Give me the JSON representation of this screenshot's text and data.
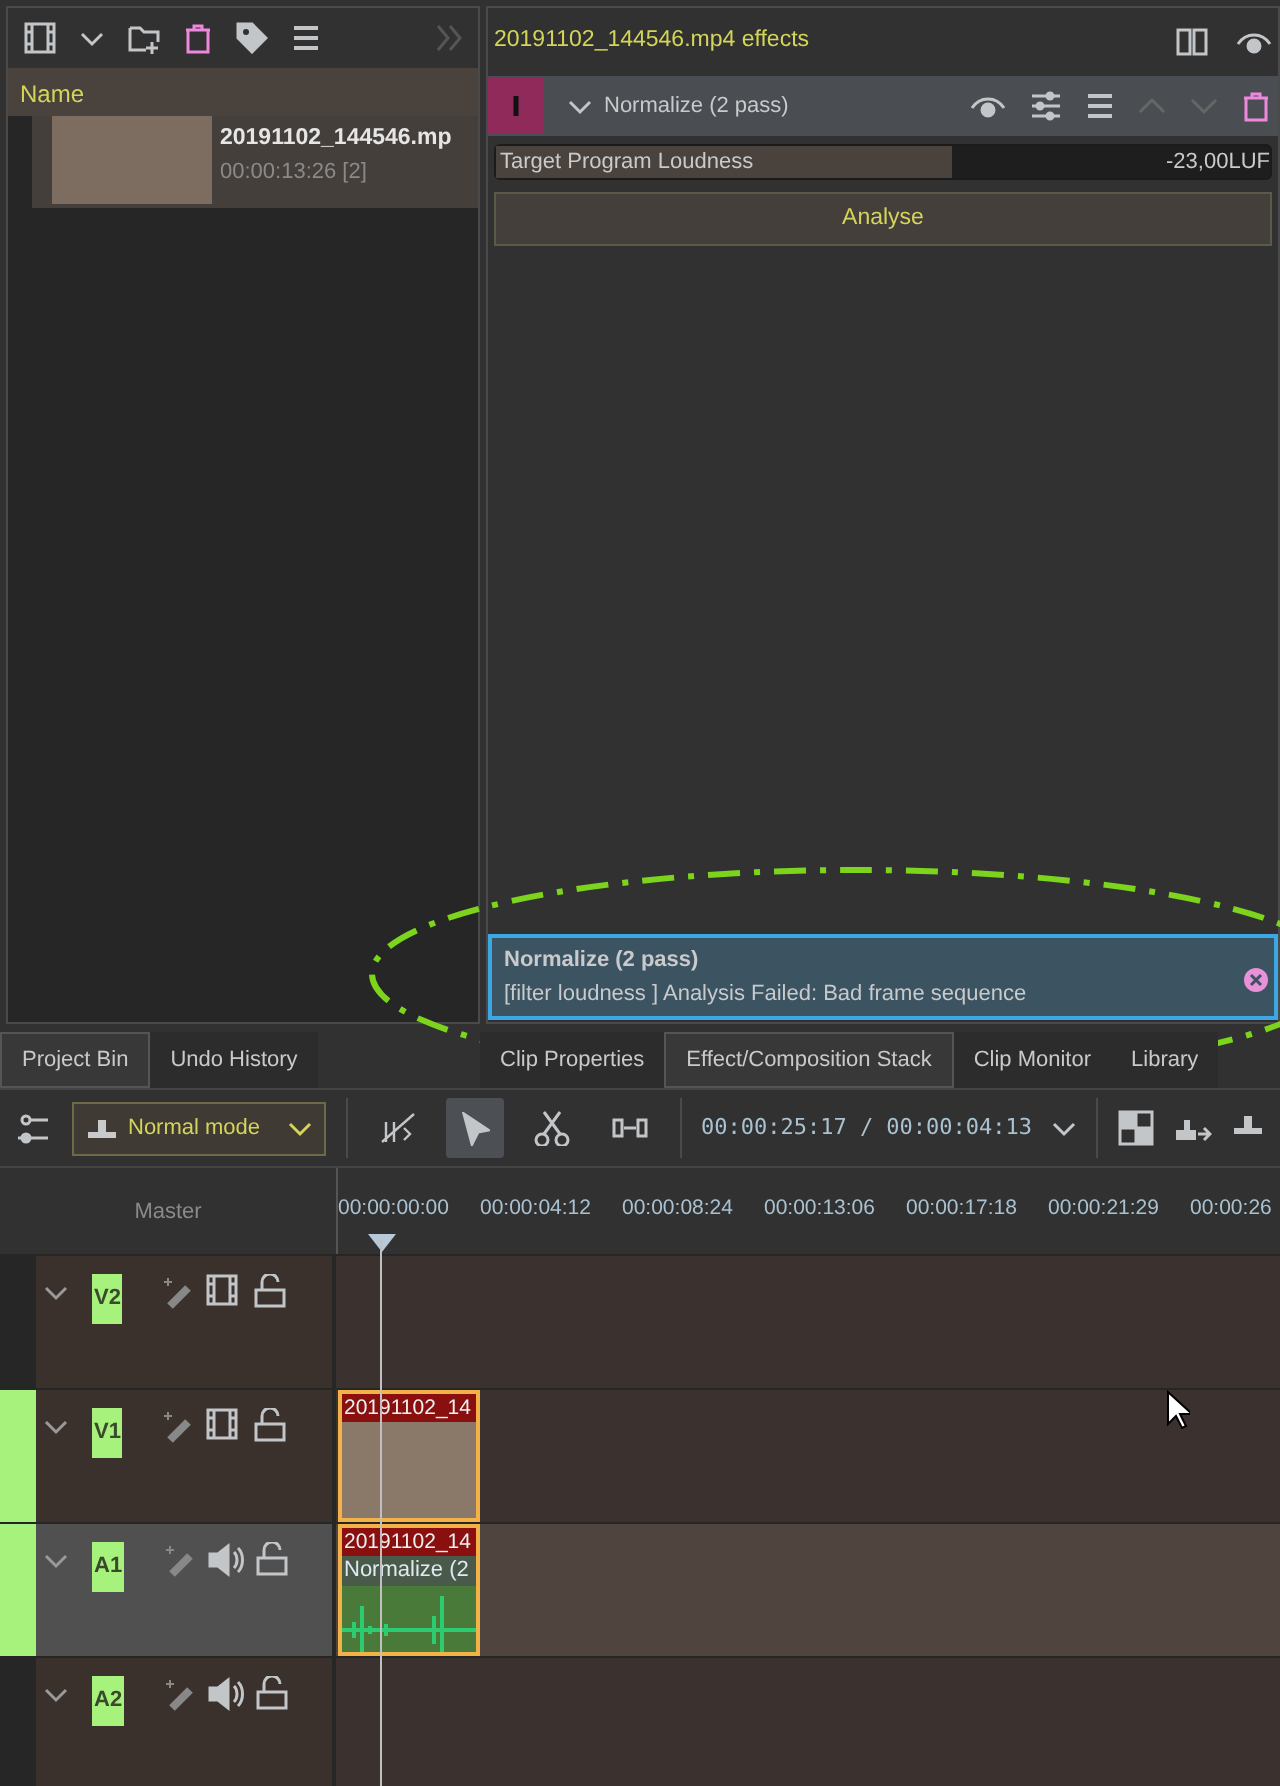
{
  "bin": {
    "column_header": "Name",
    "items": [
      {
        "name": "20191102_144546.mp",
        "duration": "00:00:13:26 [2]"
      }
    ]
  },
  "effects": {
    "title": "20191102_144546.mp4 effects",
    "effect": {
      "name": "Normalize (2 pass)",
      "expanded": true
    },
    "parameter": {
      "label": "Target Program Loudness",
      "value": "-23,00LUF",
      "level": 0.59
    },
    "button": "Analyse"
  },
  "notification": {
    "title": "Normalize (2 pass)",
    "message": "[filter loudness ] Analysis Failed: Bad frame sequence"
  },
  "left_tabs": [
    {
      "label": "Project Bin",
      "selected": true
    },
    {
      "label": "Undo History",
      "selected": false
    }
  ],
  "right_tabs": [
    {
      "label": "Clip Properties",
      "selected": false
    },
    {
      "label": "Effect/Composition Stack",
      "selected": true
    },
    {
      "label": "Clip Monitor",
      "selected": false
    },
    {
      "label": "Library",
      "selected": false
    }
  ],
  "toolbar": {
    "mode": "Normal mode",
    "tools": [
      {
        "kind": "multicam",
        "selected": false
      },
      {
        "kind": "select",
        "selected": true
      },
      {
        "kind": "razor",
        "selected": false
      },
      {
        "kind": "spacer",
        "selected": false
      }
    ],
    "timecode": "00:00:25:17 / 00:00:04:13"
  },
  "timeline": {
    "master": "Master",
    "ruler": [
      "00:00:00:00",
      "00:00:04:12",
      "00:00:08:24",
      "00:00:13:06",
      "00:00:17:18",
      "00:00:21:29",
      "00:00:26"
    ],
    "tracks": [
      {
        "label": "V2",
        "kind": "video",
        "active": false,
        "selected": false
      },
      {
        "label": "V1",
        "kind": "video",
        "active": true,
        "selected": false,
        "clips": [
          {
            "kind": "video",
            "title": "20191102_14"
          }
        ]
      },
      {
        "label": "A1",
        "kind": "audio",
        "active": true,
        "selected": true,
        "clips": [
          {
            "kind": "audio",
            "title": "20191102_14",
            "effect": "Normalize (2"
          }
        ]
      },
      {
        "label": "A2",
        "kind": "audio",
        "active": false,
        "selected": false
      }
    ]
  }
}
